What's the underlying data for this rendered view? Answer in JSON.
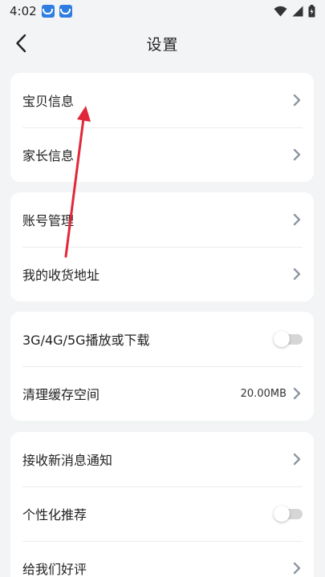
{
  "status_bar": {
    "time": "4:02",
    "app_icons": [
      "app-icon",
      "app-icon"
    ],
    "icons": [
      "wifi-icon",
      "signal-icon",
      "battery-icon"
    ]
  },
  "header": {
    "title": "设置",
    "back_icon": "chevron-left-icon"
  },
  "groups": [
    {
      "items": [
        {
          "label": "宝贝信息",
          "type": "link"
        },
        {
          "label": "家长信息",
          "type": "link"
        }
      ]
    },
    {
      "items": [
        {
          "label": "账号管理",
          "type": "link"
        },
        {
          "label": "我的收货地址",
          "type": "link"
        }
      ]
    },
    {
      "items": [
        {
          "label": "3G/4G/5G播放或下载",
          "type": "toggle",
          "on": false
        },
        {
          "label": "清理缓存空间",
          "type": "link",
          "value": "20.00MB"
        }
      ]
    },
    {
      "items": [
        {
          "label": "接收新消息通知",
          "type": "link"
        },
        {
          "label": "个性化推荐",
          "type": "toggle",
          "on": false
        },
        {
          "label": "给我们好评",
          "type": "link"
        }
      ]
    }
  ],
  "colors": {
    "background": "#f3f4f6",
    "card": "#ffffff",
    "chevron": "#8e96a3",
    "annotation_arrow": "#e0283a",
    "status_app": "#2f7de1"
  }
}
